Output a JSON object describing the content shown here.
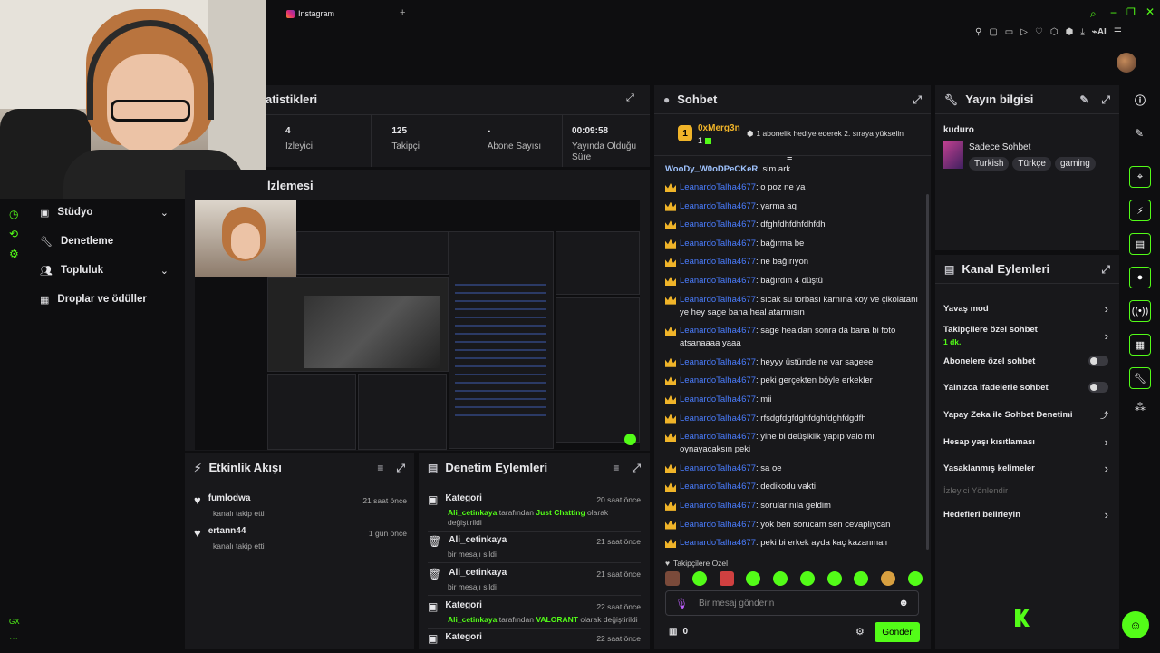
{
  "topbar": {
    "tab_label": "Instagram",
    "ai_label": "AI"
  },
  "stats": {
    "title": "atistikleri",
    "items": [
      {
        "value": "4",
        "label": "İzleyici"
      },
      {
        "value": "125",
        "label": "Takipçi"
      },
      {
        "value": "-",
        "label": "Abone Sayısı"
      },
      {
        "value": "00:09:58",
        "label": "Yayında Olduğu Süre"
      }
    ]
  },
  "preview": {
    "title": "İzlemesi"
  },
  "sidebar": {
    "items": [
      {
        "label": "Stüdyo",
        "icon": "studio-icon",
        "chevron": true
      },
      {
        "label": "Denetleme",
        "icon": "wrench-icon",
        "chevron": false
      },
      {
        "label": "Topluluk",
        "icon": "community-icon",
        "chevron": true
      },
      {
        "label": "Droplar ve ödüller",
        "icon": "drops-icon",
        "chevron": false
      }
    ],
    "bottom_label": "GX"
  },
  "activity": {
    "title": "Etkinlik Akışı",
    "items": [
      {
        "user": "fumlodwa",
        "desc": "kanalı takip etti",
        "time": "21 saat önce"
      },
      {
        "user": "ertann44",
        "desc": "kanalı takip etti",
        "time": "1 gün önce"
      }
    ]
  },
  "modactions": {
    "title": "Denetim Eylemleri",
    "items": [
      {
        "title": "Kategori",
        "user": "Ali_cetinkaya",
        "mid": " tarafından ",
        "cat": "Just Chatting",
        "rest": " olarak değiştirildi",
        "time": "20 saat önce",
        "type": "category"
      },
      {
        "title": "Ali_cetinkaya",
        "plain": "bir mesajı sildi",
        "time": "21 saat önce",
        "type": "delete"
      },
      {
        "title": "Ali_cetinkaya",
        "plain": "bir mesajı sildi",
        "time": "21 saat önce",
        "type": "delete"
      },
      {
        "title": "Kategori",
        "user": "Ali_cetinkaya",
        "mid": " tarafından ",
        "cat": "VALORANT",
        "rest": " olarak değiştirildi",
        "time": "22 saat önce",
        "type": "category"
      },
      {
        "title": "Kategori",
        "plain": "",
        "time": "22 saat önce",
        "type": "category"
      }
    ]
  },
  "chat": {
    "title": "Sohbet",
    "pinned": {
      "user": "0xMerg3n",
      "badge": "1",
      "count": "1",
      "text": "1 abonelik hediye ederek 2. sıraya yükselin"
    },
    "first_line": {
      "user": "WooDy_W0oDPeCKeR",
      "text": ": sim ark"
    },
    "messages": [
      {
        "user": "LeanardoTalha4677",
        "text": ": o poz ne ya"
      },
      {
        "user": "LeanardoTalha4677",
        "text": ": yarma aq"
      },
      {
        "user": "LeanardoTalha4677",
        "text": ": dfghfdhfdhfdhfdh"
      },
      {
        "user": "LeanardoTalha4677",
        "text": ": bağırma be"
      },
      {
        "user": "LeanardoTalha4677",
        "text": ": ne bağırıyon"
      },
      {
        "user": "LeanardoTalha4677",
        "text": ": bağırdın 4 düştü"
      },
      {
        "user": "LeanardoTalha4677",
        "text": ": sıcak su torbası karnına koy ve çikolatanı ye hey sage bana heal atarmısın"
      },
      {
        "user": "LeanardoTalha4677",
        "text": ": sage healdan sonra da bana bi foto atsanaaaa yaaa"
      },
      {
        "user": "LeanardoTalha4677",
        "text": ": heyyy üstünde ne var sageee"
      },
      {
        "user": "LeanardoTalha4677",
        "text": ": peki gerçekten böyle erkekler"
      },
      {
        "user": "LeanardoTalha4677",
        "text": ": mii"
      },
      {
        "user": "LeanardoTalha4677",
        "text": ": rfsdgfdgfdghfdghfdghfdgdfh"
      },
      {
        "user": "LeanardoTalha4677",
        "text": ": yine bi deüşiklik yapıp valo mı oynayacaksın peki"
      },
      {
        "user": "LeanardoTalha4677",
        "text": ": sa oe"
      },
      {
        "user": "LeanardoTalha4677",
        "text": ": dedikodu vakti"
      },
      {
        "user": "LeanardoTalha4677",
        "text": ": sorularınıla geldim"
      },
      {
        "user": "LeanardoTalha4677",
        "text": ": yok ben sorucam sen cevaplıycan"
      },
      {
        "user": "LeanardoTalha4677",
        "text": ": peki bi erkek ayda kaç kazanmalı"
      }
    ],
    "followers_only": "Takipçilere Özel",
    "input_placeholder": "Bir mesaj gönderin",
    "points": "0",
    "send_label": "Gönder"
  },
  "streaminfo": {
    "title": "Yayın bilgisi",
    "username": "kuduro",
    "category": "Sadece Sohbet",
    "tags": [
      "Turkish",
      "Türkçe",
      "gaming"
    ]
  },
  "channelactions": {
    "title": "Kanal Eylemleri",
    "items": [
      {
        "label": "Yavaş mod",
        "kind": "chevron"
      },
      {
        "label": "Takipçilere özel sohbet",
        "sub": "1 dk.",
        "kind": "chevron"
      },
      {
        "label": "Abonelere özel sohbet",
        "kind": "toggle"
      },
      {
        "label": "Yalnızca ifadelerle sohbet",
        "kind": "toggle"
      },
      {
        "label": "Yapay Zeka ile Sohbet Denetimi",
        "kind": "external"
      },
      {
        "label": "Hesap yaşı kısıtlaması",
        "kind": "chevron"
      },
      {
        "label": "Yasaklanmış kelimeler",
        "kind": "chevron"
      },
      {
        "label": "İzleyici Yönlendir",
        "kind": "disabled"
      },
      {
        "label": "Hedefleri belirleyin",
        "kind": "chevron"
      }
    ]
  }
}
